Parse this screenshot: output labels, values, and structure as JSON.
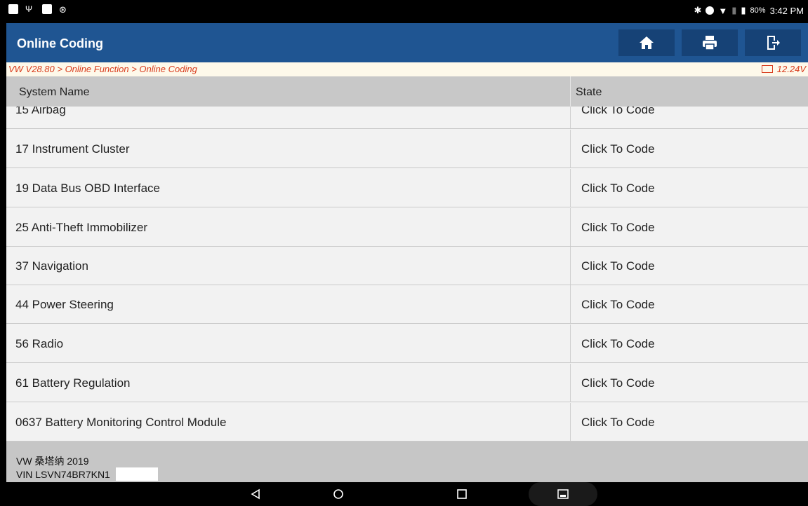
{
  "status_bar": {
    "battery_percent": "80%",
    "time": "3:42 PM"
  },
  "app_bar": {
    "title": "Online Coding",
    "buttons": [
      "home-icon",
      "print-icon",
      "exit-icon"
    ]
  },
  "breadcrumb": {
    "path": "VW V28.80 > Online Function > Online Coding",
    "voltage": "12.24V"
  },
  "table": {
    "headers": {
      "system_name": "System Name",
      "state": "State"
    },
    "rows": [
      {
        "name": "15 Airbag",
        "state": "Click To Code"
      },
      {
        "name": "17 Instrument Cluster",
        "state": "Click To Code"
      },
      {
        "name": "19 Data Bus OBD Interface",
        "state": "Click To Code"
      },
      {
        "name": "25 Anti-Theft Immobilizer",
        "state": "Click To Code"
      },
      {
        "name": "37 Navigation",
        "state": "Click To Code"
      },
      {
        "name": "44 Power Steering",
        "state": "Click To Code"
      },
      {
        "name": "56 Radio",
        "state": "Click To Code"
      },
      {
        "name": "61 Battery Regulation",
        "state": "Click To Code"
      },
      {
        "name": "0637 Battery Monitoring Control Module",
        "state": "Click To Code"
      }
    ]
  },
  "footer": {
    "vehicle": "VW 桑塔纳 2019",
    "vin": "VIN LSVN74BR7KN1"
  },
  "colors": {
    "app_bar": "#1f5592",
    "breadcrumb_text": "#d83b1c",
    "header_bg": "#c8c8c8"
  }
}
